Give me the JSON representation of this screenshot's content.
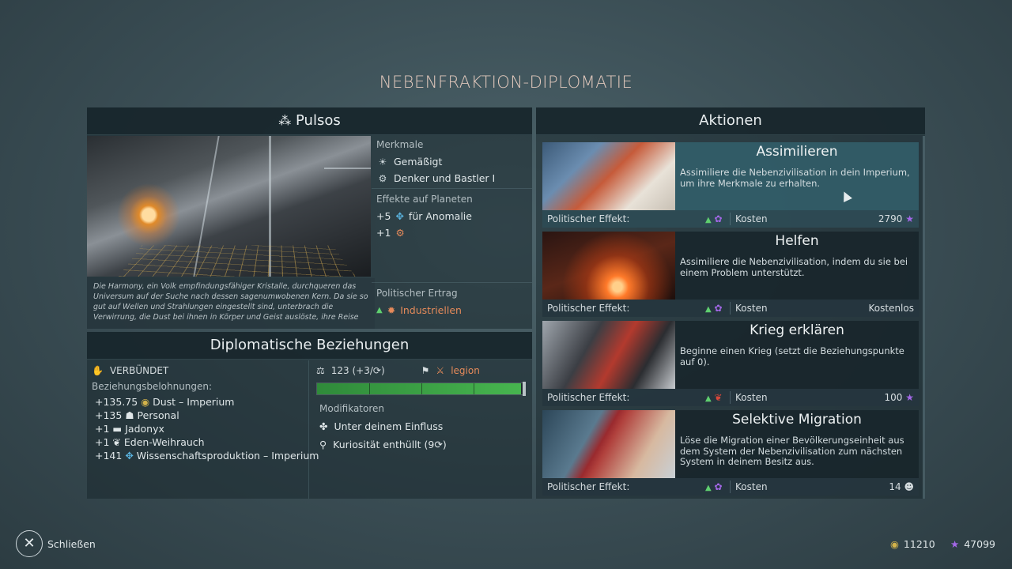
{
  "title": "NEBENFRAKTION-DIPLOMATIE",
  "faction": {
    "name": "Pulsos",
    "description": "Die Harmony, ein Volk empfindungsfähiger Kristalle, durchqueren das Universum auf der Suche nach dessen sagenumwobenen Kern. Da sie so gut auf Wellen und Strahlungen eingestellt sind, unterbrach die Verwirrung, die Dust bei ihnen in Körper und Geist auslöste, ihre Reise",
    "traits_label": "Merkmale",
    "traits": [
      "Gemäßigt",
      "Denker und Bastler I"
    ],
    "effects_label": "Effekte auf Planeten",
    "effects": [
      {
        "value": "+5",
        "text": "für Anomalie"
      },
      {
        "value": "+1",
        "text": ""
      }
    ],
    "political_label": "Politischer Ertrag",
    "political_value": "Industriellen"
  },
  "relations": {
    "header": "Diplomatische Beziehungen",
    "status": "VERBÜNDET",
    "rewards_label": "Beziehungsbelohnungen:",
    "rewards": [
      {
        "value": "+135.75",
        "text": "Dust – Imperium",
        "icon": "dust-icon"
      },
      {
        "value": "+135",
        "text": "Personal",
        "icon": "personnel-icon"
      },
      {
        "value": "+1",
        "text": "Jadonyx",
        "icon": "jadonyx-icon"
      },
      {
        "value": "+1",
        "text": "Eden-Weihrauch",
        "icon": "lotus-icon"
      },
      {
        "value": "+141",
        "text": "Wissenschaftsproduktion – Imperium",
        "icon": "science-icon"
      }
    ],
    "score": "123 (+3/",
    "score_suffix": ")",
    "faction_tag": "legion",
    "bar_fill": 0.985,
    "modifiers_label": "Modifikatoren",
    "modifiers": [
      "Unter deinem Einfluss",
      "Kuriosität enthüllt (9"
    ],
    "modifier_suffix": ")"
  },
  "actions": {
    "header": "Aktionen",
    "effect_label": "Politischer Effekt:",
    "cost_label": "Kosten",
    "items": [
      {
        "title": "Assimilieren",
        "desc": "Assimiliere die Nebenzivilisation in dein Imperium, um ihre Merkmale zu erhalten.",
        "cost": "2790",
        "cost_icon": "influence-icon"
      },
      {
        "title": "Helfen",
        "desc": "Assimiliere die Nebenzivilisation, indem du sie bei einem Problem unterstützt.",
        "cost": "Kostenlos",
        "cost_icon": ""
      },
      {
        "title": "Krieg erklären",
        "desc": "Beginne einen Krieg (setzt die Beziehungspunkte auf 0).",
        "cost": "100",
        "cost_icon": "influence-icon"
      },
      {
        "title": "Selektive Migration",
        "desc": "Löse die Migration einer Bevölkerungseinheit aus dem System der Nebenzivilisation zum nächsten System in deinem Besitz aus.",
        "cost": "14",
        "cost_icon": "population-icon"
      }
    ]
  },
  "footer": {
    "close_label": "Schließen",
    "dust": "11210",
    "influence": "47099"
  },
  "colors": {
    "accent_orange": "#e58a5a",
    "positive_green": "#5fcf6f",
    "influence_purple": "#a468e8",
    "selected_card": "#366470"
  }
}
